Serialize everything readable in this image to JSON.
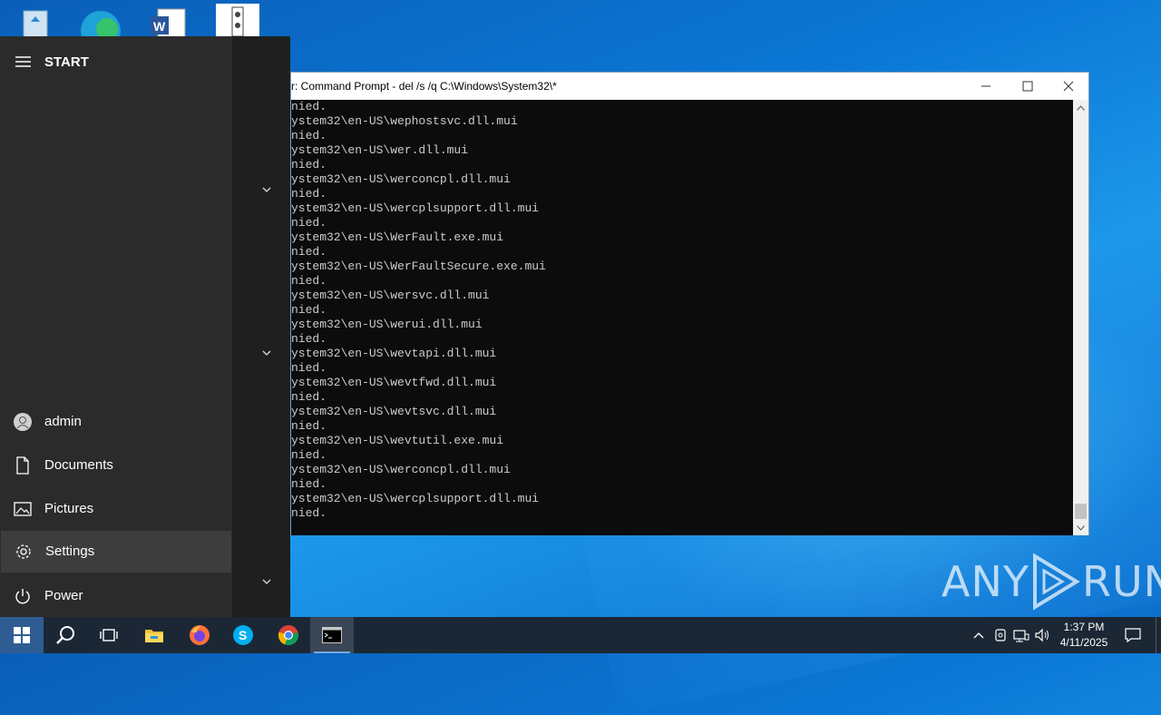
{
  "desktop": {
    "icons": [
      "recycle-bin-icon",
      "edge-icon",
      "word-document-icon",
      "program-icon"
    ]
  },
  "cmd": {
    "title": "r: Command Prompt - del  /s /q C:\\Windows\\System32\\*",
    "lines": [
      "nied.",
      "ystem32\\en-US\\wephostsvc.dll.mui",
      "nied.",
      "ystem32\\en-US\\wer.dll.mui",
      "nied.",
      "ystem32\\en-US\\werconcpl.dll.mui",
      "nied.",
      "ystem32\\en-US\\wercplsupport.dll.mui",
      "nied.",
      "ystem32\\en-US\\WerFault.exe.mui",
      "nied.",
      "ystem32\\en-US\\WerFaultSecure.exe.mui",
      "nied.",
      "ystem32\\en-US\\wersvc.dll.mui",
      "nied.",
      "ystem32\\en-US\\werui.dll.mui",
      "nied.",
      "ystem32\\en-US\\wevtapi.dll.mui",
      "nied.",
      "ystem32\\en-US\\wevtfwd.dll.mui",
      "nied.",
      "ystem32\\en-US\\wevtsvc.dll.mui",
      "nied.",
      "ystem32\\en-US\\wevtutil.exe.mui",
      "nied.",
      "ystem32\\en-US\\werconcpl.dll.mui",
      "nied.",
      "ystem32\\en-US\\wercplsupport.dll.mui",
      "nied."
    ]
  },
  "start_menu": {
    "title": "START",
    "items": [
      {
        "label": "admin",
        "icon": "user-icon"
      },
      {
        "label": "Documents",
        "icon": "document-icon"
      },
      {
        "label": "Pictures",
        "icon": "pictures-icon"
      },
      {
        "label": "Settings",
        "icon": "gear-icon"
      },
      {
        "label": "Power",
        "icon": "power-icon"
      }
    ]
  },
  "taskbar": {
    "apps": [
      "windows-start-icon",
      "search-icon",
      "task-view-icon",
      "file-explorer-icon",
      "firefox-icon",
      "skype-icon",
      "chrome-icon",
      "command-prompt-icon"
    ],
    "time": "1:37 PM",
    "date": "4/11/2025"
  },
  "watermark": {
    "left": "ANY",
    "right": "RUN"
  },
  "colors": {
    "start_bg": "#2b2b2b",
    "taskbar_bg": "#1c2735",
    "cmd_bg": "#0c0c0c",
    "cmd_text": "#cccccc"
  }
}
